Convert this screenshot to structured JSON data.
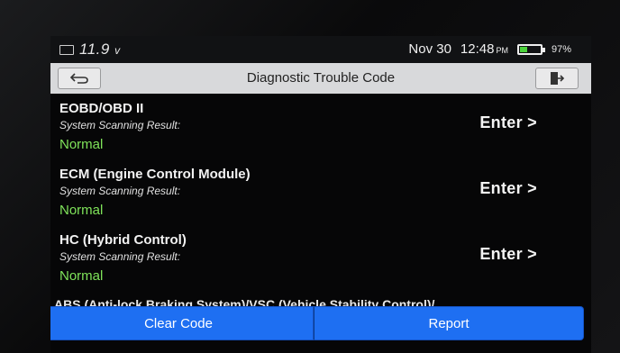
{
  "status_bar": {
    "voltage": "11.9",
    "voltage_unit": "v",
    "date": "Nov 30",
    "time": "12:48",
    "ampm": "PM",
    "battery_percent": "97%"
  },
  "title_bar": {
    "title": "Diagnostic Trouble Code",
    "back_icon": "back-arrow-icon",
    "exit_icon": "exit-icon"
  },
  "systems": [
    {
      "name": "EOBD/OBD II",
      "result_label": "System Scanning Result:",
      "status": "Normal",
      "action": "Enter >"
    },
    {
      "name": "ECM (Engine Control Module)",
      "result_label": "System Scanning Result:",
      "status": "Normal",
      "action": "Enter >"
    },
    {
      "name": "HC (Hybrid Control)",
      "result_label": "System Scanning Result:",
      "status": "Normal",
      "action": "Enter >"
    }
  ],
  "partial_item": "ABS (Anti-lock Braking System)/VSC (Vehicle Stability Control)/",
  "bottom_bar": {
    "clear_code": "Clear Code",
    "report": "Report"
  },
  "colors": {
    "accent": "#1e6ff2",
    "status_ok": "#7fe35a"
  }
}
